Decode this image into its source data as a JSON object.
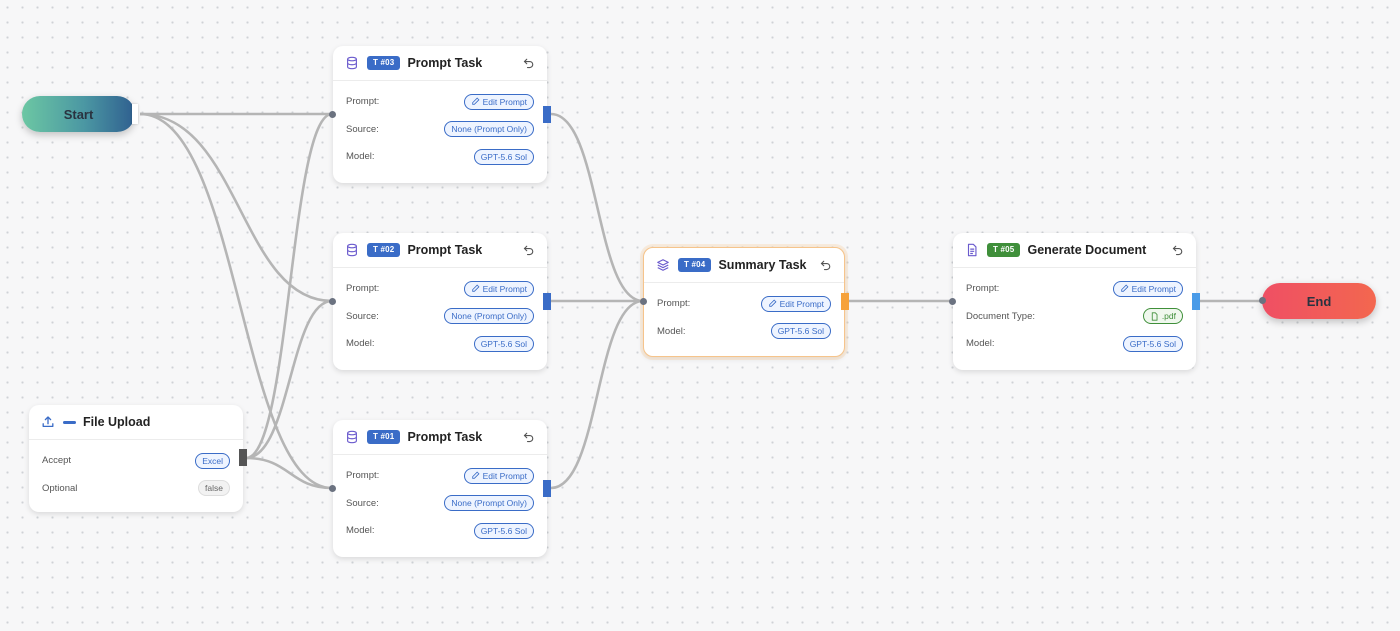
{
  "start": {
    "label": "Start"
  },
  "end": {
    "label": "End"
  },
  "file_upload": {
    "icon": "upload-icon",
    "title": "File Upload",
    "rows": [
      {
        "label": "Accept",
        "value": "Excel"
      },
      {
        "label": "Optional",
        "value": "false"
      }
    ]
  },
  "tasks": {
    "t03": {
      "badge": "T #03",
      "title": "Prompt Task",
      "icon": "database-icon",
      "prompt_label": "Prompt:",
      "prompt_value": "Edit Prompt",
      "source_label": "Source:",
      "source_value": "None (Prompt Only)",
      "model_label": "Model:",
      "model_value": "GPT-5.6 Sol"
    },
    "t02": {
      "badge": "T #02",
      "title": "Prompt Task",
      "icon": "database-icon",
      "prompt_label": "Prompt:",
      "prompt_value": "Edit Prompt",
      "source_label": "Source:",
      "source_value": "None (Prompt Only)",
      "model_label": "Model:",
      "model_value": "GPT-5.6 Sol"
    },
    "t01": {
      "badge": "T #01",
      "title": "Prompt Task",
      "icon": "database-icon",
      "prompt_label": "Prompt:",
      "prompt_value": "Edit Prompt",
      "source_label": "Source:",
      "source_value": "None (Prompt Only)",
      "model_label": "Model:",
      "model_value": "GPT-5.6 Sol"
    },
    "t04": {
      "badge": "T #04",
      "title": "Summary Task",
      "icon": "layers-icon",
      "prompt_label": "Prompt:",
      "prompt_value": "Edit Prompt",
      "model_label": "Model:",
      "model_value": "GPT-5.6 Sol"
    },
    "t05": {
      "badge": "T #05",
      "title": "Generate Document",
      "icon": "document-icon",
      "prompt_label": "Prompt:",
      "prompt_value": "Edit Prompt",
      "doctype_label": "Document Type:",
      "doctype_value": ".pdf",
      "model_label": "Model:",
      "model_value": "GPT-5.6 Sol"
    }
  },
  "colors": {
    "badge_blue": "#3a6cc7",
    "badge_green": "#3f8f3a",
    "handle_orange": "#f6a23b",
    "edge_gray": "#b5b5b5"
  }
}
